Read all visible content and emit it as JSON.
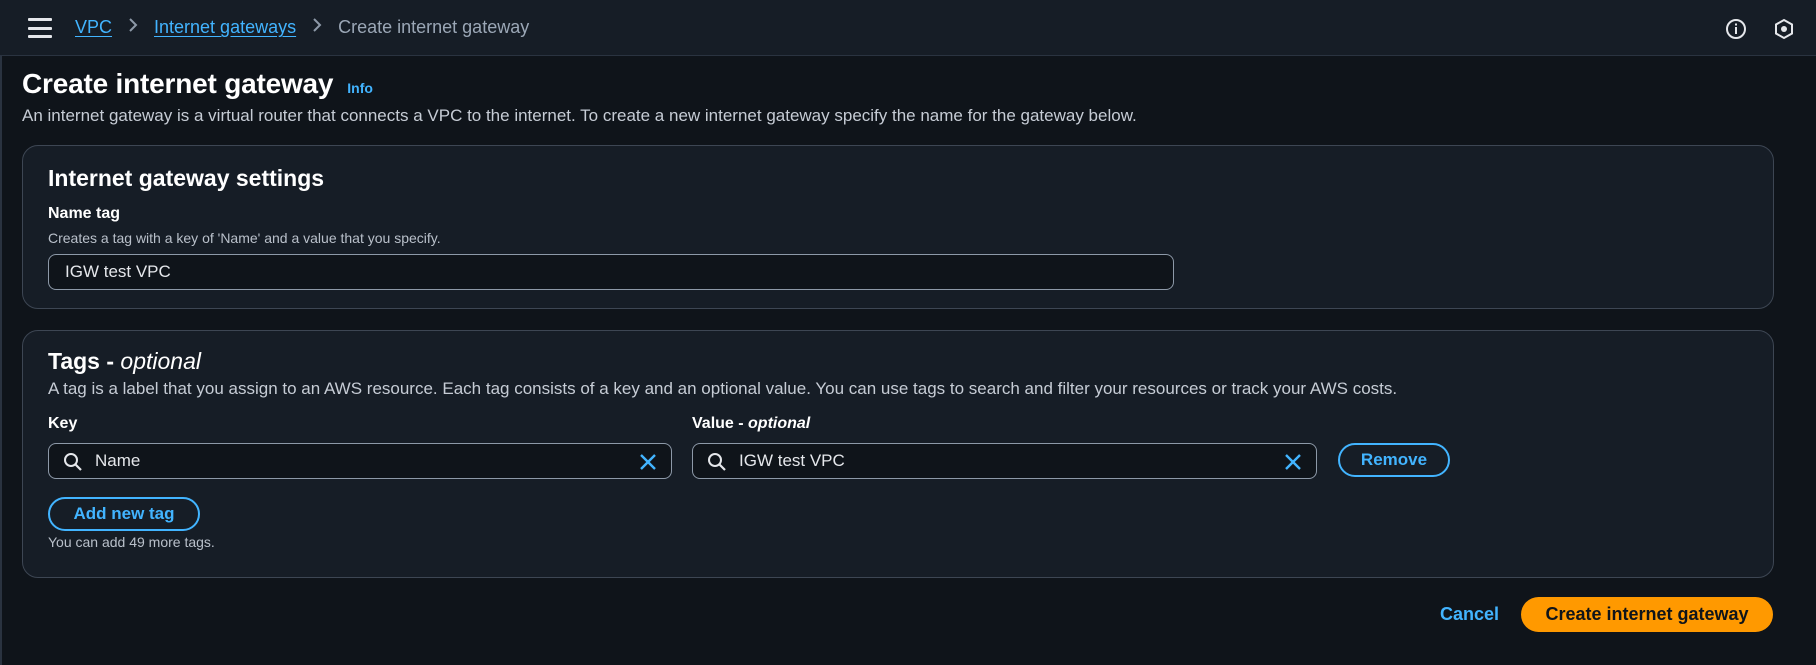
{
  "topbar": {
    "menu_icon": "hamburger-menu-icon",
    "breadcrumb": {
      "vpc": "VPC",
      "internet_gateways": "Internet gateways",
      "current": "Create internet gateway"
    },
    "info_icon": "info-circle-icon",
    "settings_icon": "hexagon-icon"
  },
  "page": {
    "title": "Create internet gateway",
    "info_link": "Info",
    "description": "An internet gateway is a virtual router that connects a VPC to the internet. To create a new internet gateway specify the name for the gateway below."
  },
  "settings_panel": {
    "title": "Internet gateway settings",
    "name_tag": {
      "label": "Name tag",
      "description": "Creates a tag with a key of 'Name' and a value that you specify.",
      "value": "IGW test VPC"
    }
  },
  "tags_panel": {
    "title": "Tags - ",
    "title_suffix": "optional",
    "description": "A tag is a label that you assign to an AWS resource. Each tag consists of a key and an optional value. You can use tags to search and filter your resources or track your AWS costs.",
    "key_label": "Key",
    "value_label": "Value - ",
    "value_label_suffix": "optional",
    "rows": [
      {
        "key": "Name",
        "value": "IGW test VPC",
        "remove_label": "Remove"
      }
    ],
    "add_button": "Add new tag",
    "hint": "You can add 49 more tags."
  },
  "footer": {
    "cancel": "Cancel",
    "submit": "Create internet gateway"
  },
  "colors": {
    "background": "#0f141a",
    "panel": "#161d26",
    "link": "#42b4ff",
    "primary": "#ff9900"
  }
}
